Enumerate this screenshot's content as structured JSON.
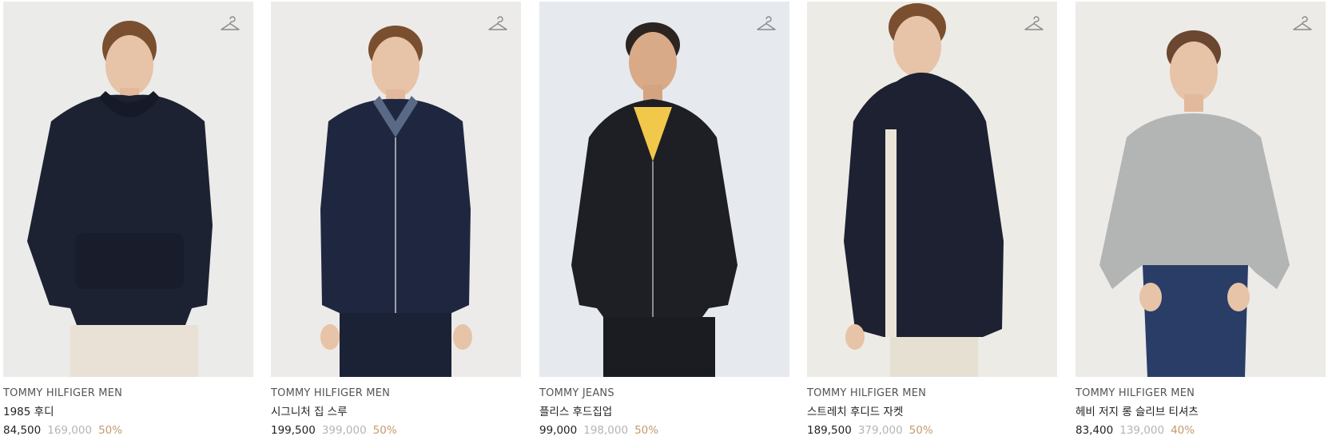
{
  "products": [
    {
      "brand": "TOMMY HILFIGER MEN",
      "name": "1985 후디",
      "price": "84,500",
      "original_price": "169,000",
      "discount": "50%",
      "garment_color": "#1d2233",
      "pants_color": "#e9e1d6",
      "icon": "hanger-icon"
    },
    {
      "brand": "TOMMY HILFIGER MEN",
      "name": "시그니처 집 스루",
      "price": "199,500",
      "original_price": "399,000",
      "discount": "50%",
      "garment_color": "#1f2740",
      "pants_color": "#1c2236",
      "icon": "hanger-icon"
    },
    {
      "brand": "TOMMY JEANS",
      "name": "플리스 후드집업",
      "price": "99,000",
      "original_price": "198,000",
      "discount": "50%",
      "garment_color": "#1e1f24",
      "pants_color": "#1b1c21",
      "icon": "hanger-icon"
    },
    {
      "brand": "TOMMY HILFIGER MEN",
      "name": "스트레치 후디드 자켓",
      "price": "189,500",
      "original_price": "379,000",
      "discount": "50%",
      "garment_color": "#1d2132",
      "pants_color": "#e6e0d3",
      "icon": "hanger-icon"
    },
    {
      "brand": "TOMMY HILFIGER MEN",
      "name": "헤비 저지 롱 슬리브 티셔츠",
      "price": "83,400",
      "original_price": "139,000",
      "discount": "40%",
      "garment_color": "#b3b4b4",
      "pants_color": "#2a3d66",
      "icon": "hanger-icon"
    }
  ],
  "colors": {
    "original_price": "#b4b4b4",
    "discount": "#c59a6b",
    "text": "#222222",
    "skin": "#e7c3a8",
    "hair_brown": "#7a4f30",
    "hair_dark": "#2b2420"
  }
}
